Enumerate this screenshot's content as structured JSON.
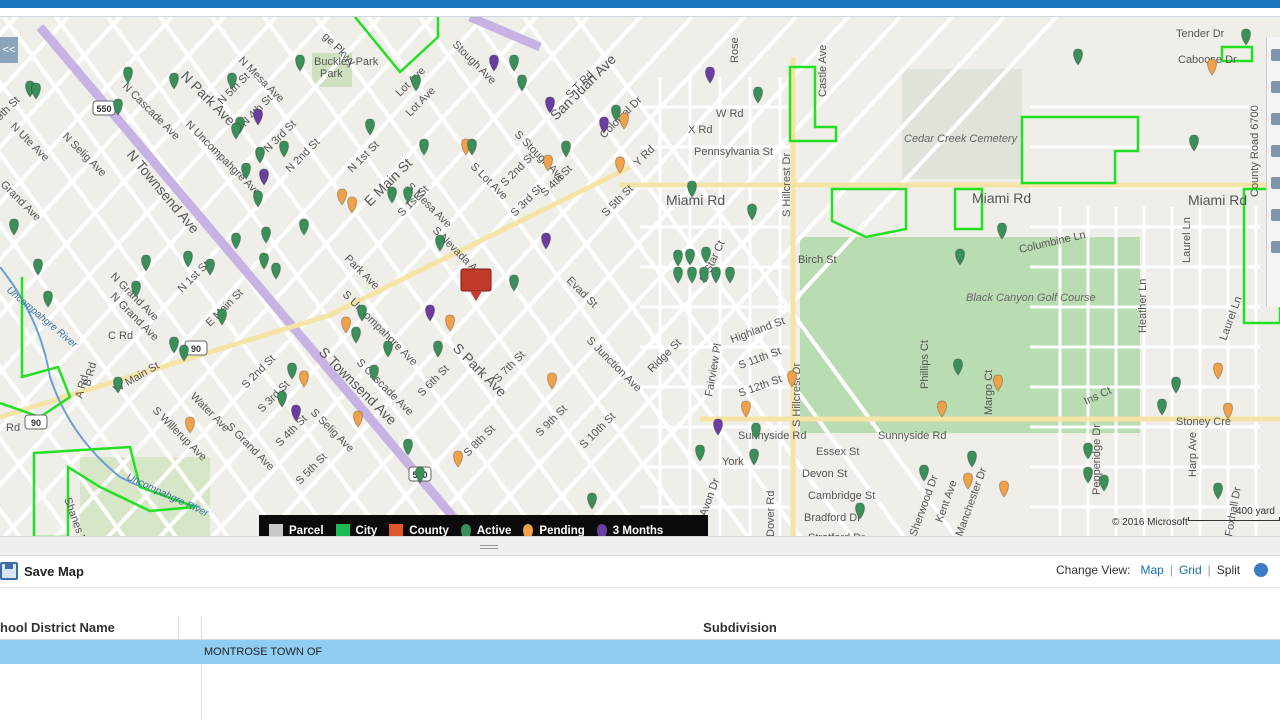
{
  "map": {
    "streets": [
      {
        "text": "N Park Ave"
      },
      {
        "text": "N Mesa Ave"
      },
      {
        "text": "N 5th St"
      },
      {
        "text": "N 4th St"
      },
      {
        "text": "N 3rd St"
      },
      {
        "text": "N 2nd St"
      },
      {
        "text": "N 1st St"
      },
      {
        "text": "N Cascade Ave"
      },
      {
        "text": "N Uncompahgre Ave"
      },
      {
        "text": "N Townsend Ave"
      },
      {
        "text": "N Selig Ave"
      },
      {
        "text": "N Ute Ave"
      },
      {
        "text": "N Grand Ave"
      },
      {
        "text": "Grand Ave"
      },
      {
        "text": "9th St"
      },
      {
        "text": "Lot Ave"
      },
      {
        "text": "E Main St"
      },
      {
        "text": "S 1st St"
      },
      {
        "text": "S Mesa Ave"
      },
      {
        "text": "S Nevada Ave"
      },
      {
        "text": "Stough Ave"
      },
      {
        "text": "S Stough Ave"
      },
      {
        "text": "S Lot Ave"
      },
      {
        "text": "S 2nd St"
      },
      {
        "text": "S 3rd St"
      },
      {
        "text": "S 4th St"
      },
      {
        "text": "S 5th St"
      },
      {
        "text": "San Juan Ave"
      },
      {
        "text": "S T Rd"
      },
      {
        "text": "Colonial Dr"
      },
      {
        "text": "Y Rd"
      },
      {
        "text": "W Rd"
      },
      {
        "text": "X Rd"
      },
      {
        "text": "Pennsylvania St"
      },
      {
        "text": "Miami Rd"
      },
      {
        "text": "Miami Rd"
      },
      {
        "text": "Miami Rd"
      },
      {
        "text": "Cedar Creek Cemetery"
      },
      {
        "text": "County Road 6700"
      },
      {
        "text": "Columbine Ln"
      },
      {
        "text": "Birch St"
      },
      {
        "text": "Black Canyon Golf Course"
      },
      {
        "text": "Heather Ln"
      },
      {
        "text": "Laurel Ln"
      },
      {
        "text": "Laurel Ln"
      },
      {
        "text": "Tender Dr"
      },
      {
        "text": "Caboose Dr"
      },
      {
        "text": "Castle Ave"
      },
      {
        "text": "S Hillcrest Dr"
      },
      {
        "text": "S Hillcrest Dr"
      },
      {
        "text": "Rose"
      },
      {
        "text": "E Star Ct"
      },
      {
        "text": "Evad St"
      },
      {
        "text": "Highland St"
      },
      {
        "text": "S Junction Ave"
      },
      {
        "text": "Ridge St"
      },
      {
        "text": "Fairview Pl"
      },
      {
        "text": "S 11th St"
      },
      {
        "text": "S 12th St"
      },
      {
        "text": "Sunnyside Rd"
      },
      {
        "text": "Sunnyside Rd"
      },
      {
        "text": "Phillips Ct"
      },
      {
        "text": "Margo Ct"
      },
      {
        "text": "Ins Ct"
      },
      {
        "text": "Stoney Cre"
      },
      {
        "text": "Essex St"
      },
      {
        "text": "Devon St"
      },
      {
        "text": "Cambridge St"
      },
      {
        "text": "Bradford Dr"
      },
      {
        "text": "Stratford Dr"
      },
      {
        "text": "Sherwood Dr"
      },
      {
        "text": "Kent Ave"
      },
      {
        "text": "Manchester Dr"
      },
      {
        "text": "Pepperidge Dr"
      },
      {
        "text": "Harp Ave"
      },
      {
        "text": "Foxhall Dr"
      },
      {
        "text": "York"
      },
      {
        "text": "Avon Dr"
      },
      {
        "text": "Dover Rd"
      },
      {
        "text": "Belle"
      },
      {
        "text": "S 6th St"
      },
      {
        "text": "S 7th St"
      },
      {
        "text": "S 8th St"
      },
      {
        "text": "S 9th St"
      },
      {
        "text": "S 10th St"
      },
      {
        "text": "S Park Ave"
      },
      {
        "text": "S Uncompahgre Ave"
      },
      {
        "text": "Park Ave"
      },
      {
        "text": "S Cascade Ave"
      },
      {
        "text": "S Townsend Ave"
      },
      {
        "text": "S Selig Ave"
      },
      {
        "text": "S 4th St"
      },
      {
        "text": "S 3rd St"
      },
      {
        "text": "S 2nd St"
      },
      {
        "text": "S 5th St"
      },
      {
        "text": "S Grand Ave"
      },
      {
        "text": "Water Ave"
      },
      {
        "text": "S Willerup Ave"
      },
      {
        "text": "W Main St"
      },
      {
        "text": "E Main St"
      },
      {
        "text": "N 1st St"
      },
      {
        "text": "N Grand Ave"
      },
      {
        "text": "C Rd"
      },
      {
        "text": "B Rd"
      },
      {
        "text": "A Rd"
      },
      {
        "text": "Rd"
      },
      {
        "text": "Shanes Way"
      },
      {
        "text": "Uncompahgre River"
      },
      {
        "text": "Uncompahgre River"
      },
      {
        "text": "Buckley Park"
      },
      {
        "text": "Park"
      },
      {
        "text": "ge Pkwy"
      },
      {
        "text": "Lot Ave"
      }
    ],
    "shields": [
      "550",
      "550",
      "90",
      "90"
    ],
    "collapse_label": "<<",
    "legend": [
      {
        "label": "Parcel",
        "color": "#c8c8c8",
        "kind": "box"
      },
      {
        "label": "City",
        "color": "#1db954",
        "kind": "box"
      },
      {
        "label": "County",
        "color": "#e0562a",
        "kind": "box"
      },
      {
        "label": "Active",
        "color": "#3a8f5b",
        "kind": "pin"
      },
      {
        "label": "Pending",
        "color": "#f0a24a",
        "kind": "pin"
      },
      {
        "label": "3 Months",
        "color": "#6a3ea1",
        "kind": "pin"
      }
    ],
    "copyright": "© 2016 Microsoft",
    "scale_label": "400 yard"
  },
  "toolbar": {
    "save_label": "Save Map",
    "change_view_label": "Change View:",
    "views": [
      "Map",
      "Grid"
    ],
    "split_label": "Split"
  },
  "grid": {
    "headers": [
      "hool District Name",
      "Subdivision"
    ],
    "rows": [
      {
        "school_district": "",
        "subdivision": "MONTROSE TOWN OF"
      }
    ]
  },
  "colors": {
    "accent": "#1b75bc",
    "selected_row": "#8fcdf3",
    "active": "#3a8f5b",
    "pending": "#f0a24a",
    "three_months": "#6a3ea1",
    "city_boundary": "#22e022",
    "selected_pin": "#c0392b"
  }
}
